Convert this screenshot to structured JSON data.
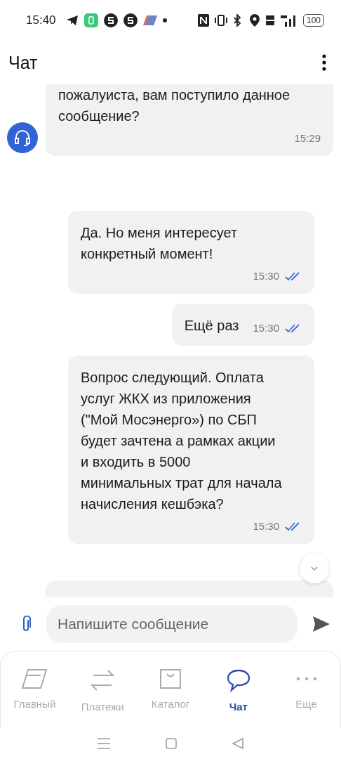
{
  "status_bar": {
    "time": "15:40",
    "battery": "100"
  },
  "header": {
    "title": "Чат"
  },
  "messages": [
    {
      "kind": "incoming",
      "text": "пожалуиста, вам поступило данное сообщение?",
      "time": "15:29"
    },
    {
      "kind": "outgoing",
      "text": "Да. Но меня интересует конкретный момент!",
      "time": "15:30",
      "read": true
    },
    {
      "kind": "outgoing",
      "text": "Ещё раз",
      "time": "15:30",
      "read": true
    },
    {
      "kind": "outgoing",
      "text": "Вопрос следующий. Оплата услуг ЖКХ из приложения (\"Мой Мосэнерго») по СБП будет зачтена а рамках акции и входить в 5000 минимальных трат для начала начисления кешбэка?",
      "time": "15:30",
      "read": true
    }
  ],
  "composer": {
    "placeholder": "Напишите сообщение"
  },
  "nav": [
    {
      "kind": "home",
      "label": "Главный",
      "selected": false
    },
    {
      "kind": "payments",
      "label": "Платежи",
      "selected": false
    },
    {
      "kind": "catalog",
      "label": "Каталог",
      "selected": false
    },
    {
      "kind": "chat",
      "label": "Чат",
      "selected": true
    },
    {
      "kind": "more",
      "label": "Еще",
      "selected": false
    }
  ]
}
